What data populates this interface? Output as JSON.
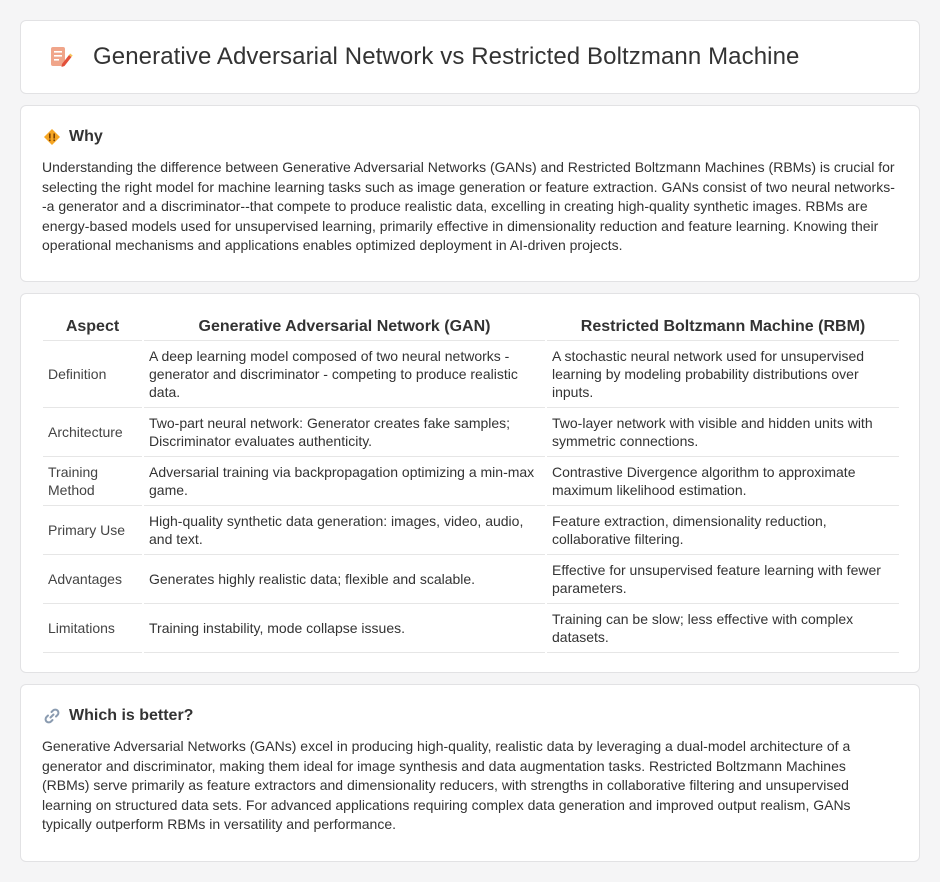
{
  "header": {
    "title": "Generative Adversarial Network vs Restricted Boltzmann Machine",
    "icon": "document-pencil-icon"
  },
  "why": {
    "title": "Why",
    "icon": "diamond-warning-icon",
    "text": "Understanding the difference between Generative Adversarial Networks (GANs) and Restricted Boltzmann Machines (RBMs) is crucial for selecting the right model for machine learning tasks such as image generation or feature extraction. GANs consist of two neural networks--a generator and a discriminator--that compete to produce realistic data, excelling in creating high-quality synthetic images. RBMs are energy-based models used for unsupervised learning, primarily effective in dimensionality reduction and feature learning. Knowing their operational mechanisms and applications enables optimized deployment in AI-driven projects."
  },
  "comparison": {
    "headers": [
      "Aspect",
      "Generative Adversarial Network (GAN)",
      "Restricted Boltzmann Machine (RBM)"
    ],
    "rows": [
      {
        "aspect": "Definition",
        "gan": "A deep learning model composed of two neural networks - generator and discriminator - competing to produce realistic data.",
        "rbm": "A stochastic neural network used for unsupervised learning by modeling probability distributions over inputs."
      },
      {
        "aspect": "Architecture",
        "gan": "Two-part neural network: Generator creates fake samples; Discriminator evaluates authenticity.",
        "rbm": "Two-layer network with visible and hidden units with symmetric connections."
      },
      {
        "aspect": "Training Method",
        "gan": "Adversarial training via backpropagation optimizing a min-max game.",
        "rbm": "Contrastive Divergence algorithm to approximate maximum likelihood estimation."
      },
      {
        "aspect": "Primary Use",
        "gan": "High-quality synthetic data generation: images, video, audio, and text.",
        "rbm": "Feature extraction, dimensionality reduction, collaborative filtering."
      },
      {
        "aspect": "Advantages",
        "gan": "Generates highly realistic data; flexible and scalable.",
        "rbm": "Effective for unsupervised feature learning with fewer parameters."
      },
      {
        "aspect": "Limitations",
        "gan": "Training instability, mode collapse issues.",
        "rbm": "Training can be slow; less effective with complex datasets."
      }
    ]
  },
  "better": {
    "title": "Which is better?",
    "icon": "link-icon",
    "text": "Generative Adversarial Networks (GANs) excel in producing high-quality, realistic data by leveraging a dual-model architecture of a generator and discriminator, making them ideal for image synthesis and data augmentation tasks. Restricted Boltzmann Machines (RBMs) serve primarily as feature extractors and dimensionality reducers, with strengths in collaborative filtering and unsupervised learning on structured data sets. For advanced applications requiring complex data generation and improved output realism, GANs typically outperform RBMs in versatility and performance."
  }
}
